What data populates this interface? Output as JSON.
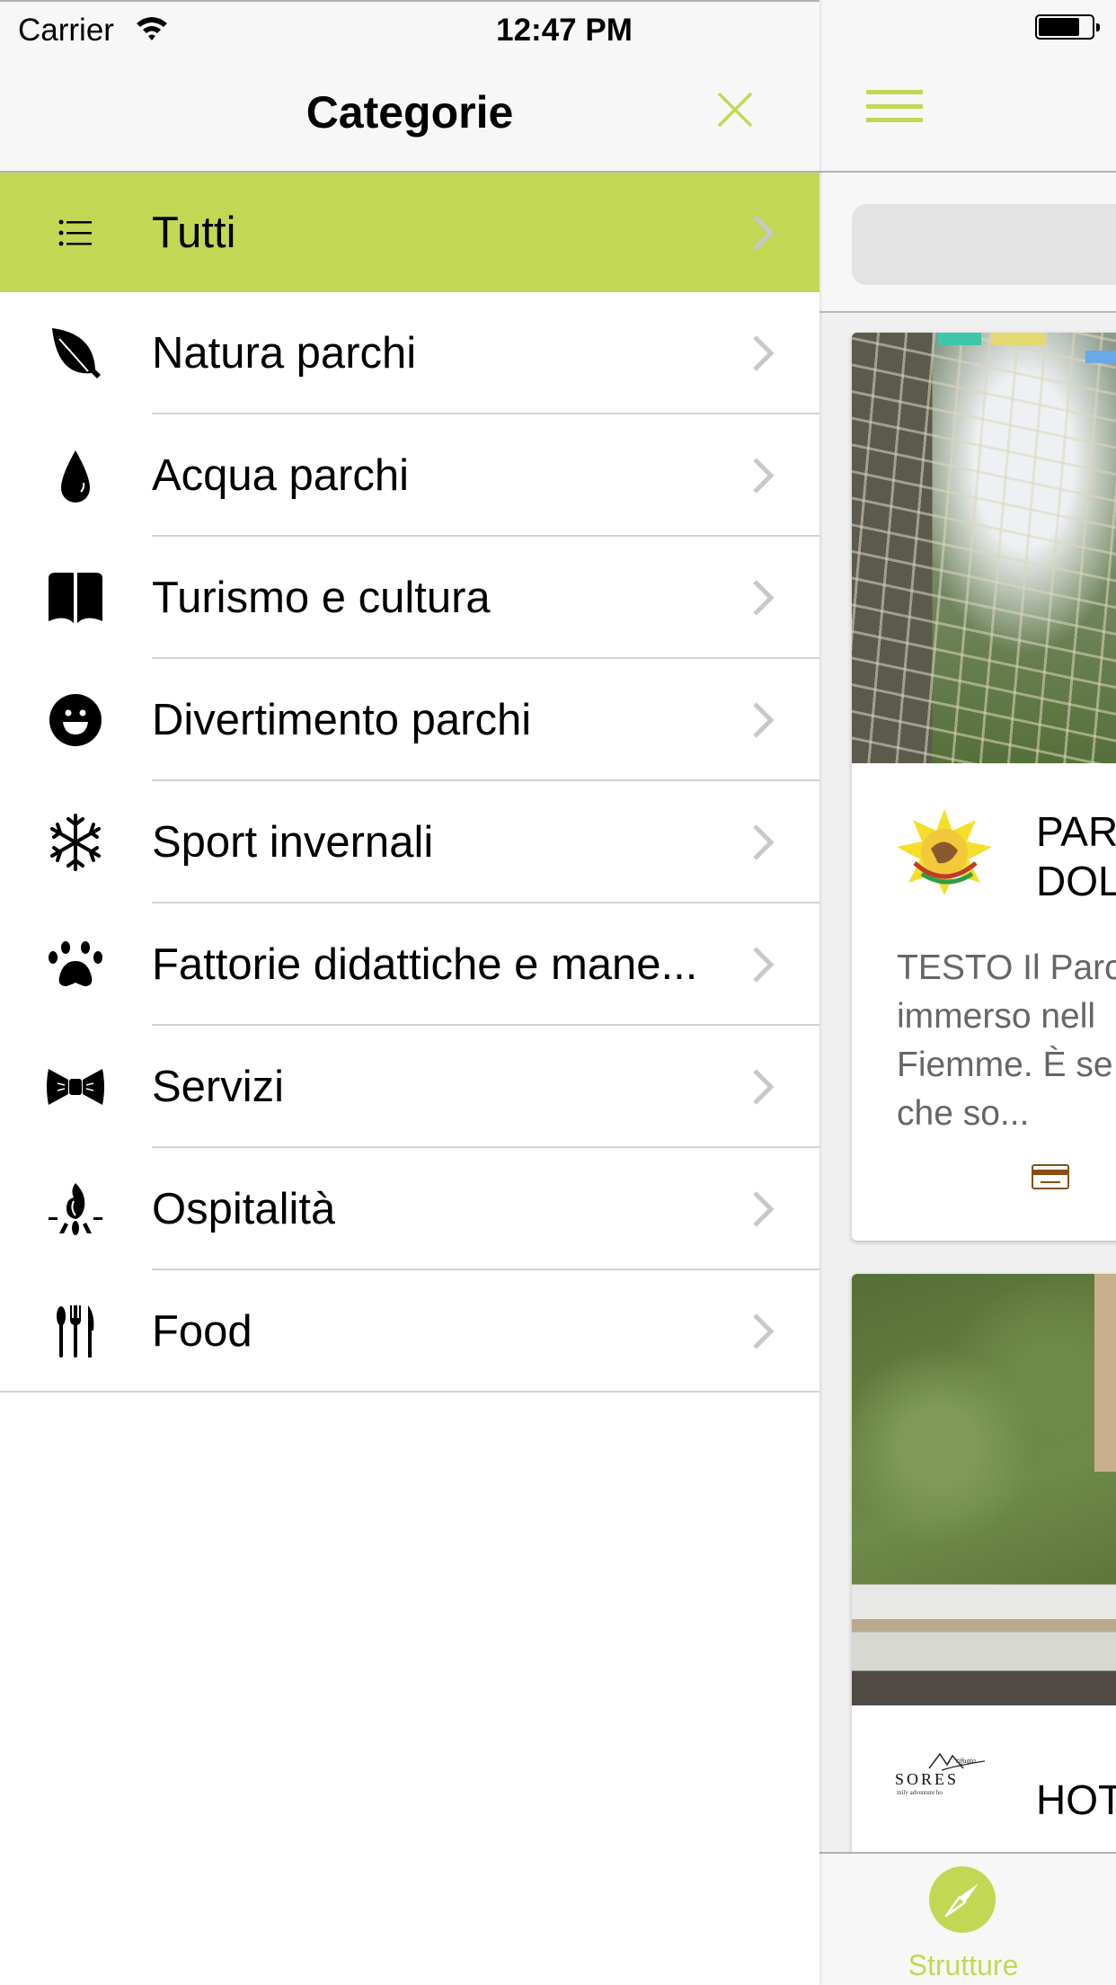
{
  "status_bar": {
    "carrier": "Carrier",
    "time": "12:47 PM",
    "battery_level_percent": 75
  },
  "menu": {
    "title": "Categorie",
    "close_icon": "close-icon",
    "items": [
      {
        "label": "Tutti",
        "icon": "list-icon",
        "active": true
      },
      {
        "label": "Natura parchi",
        "icon": "leaf-icon",
        "active": false
      },
      {
        "label": "Acqua parchi",
        "icon": "water-drop-icon",
        "active": false
      },
      {
        "label": "Turismo e cultura",
        "icon": "book-icon",
        "active": false
      },
      {
        "label": "Divertimento parchi",
        "icon": "smiley-icon",
        "active": false
      },
      {
        "label": "Sport invernali",
        "icon": "snowflake-icon",
        "active": false
      },
      {
        "label": "Fattorie didattiche e mane...",
        "icon": "paw-icon",
        "active": false
      },
      {
        "label": "Servizi",
        "icon": "bow-tie-icon",
        "active": false
      },
      {
        "label": "Ospitalità",
        "icon": "campfire-icon",
        "active": false
      },
      {
        "label": "Food",
        "icon": "cutlery-icon",
        "active": false
      }
    ]
  },
  "content": {
    "menu_icon": "hamburger-icon",
    "search": {
      "placeholder": "",
      "value": ""
    },
    "cards": [
      {
        "title_lines": [
          "PAR",
          "DOL"
        ],
        "logo": "Adventure Dolomiti logo",
        "description_lines": [
          "TESTO Il Parc",
          "immerso nell",
          "Fiemme. È se",
          "che so..."
        ],
        "icon": "credit-card-icon"
      },
      {
        "title_lines": [
          "HOT"
        ],
        "logo": "Rifugio Sores family adventure hotel logo",
        "logo_text": {
          "top": "rifugio",
          "main": "SORES",
          "sub": "mily adventure ho"
        }
      }
    ],
    "tab_bar": {
      "tabs": [
        {
          "label": "Strutture",
          "icon": "compass-icon",
          "active": true
        }
      ]
    }
  },
  "colors": {
    "accent": "#c2d855",
    "chevron": "#c7c7cc",
    "separator": "#d2d2d2",
    "description_text": "#666666",
    "payment_icon": "#8b4e12"
  }
}
